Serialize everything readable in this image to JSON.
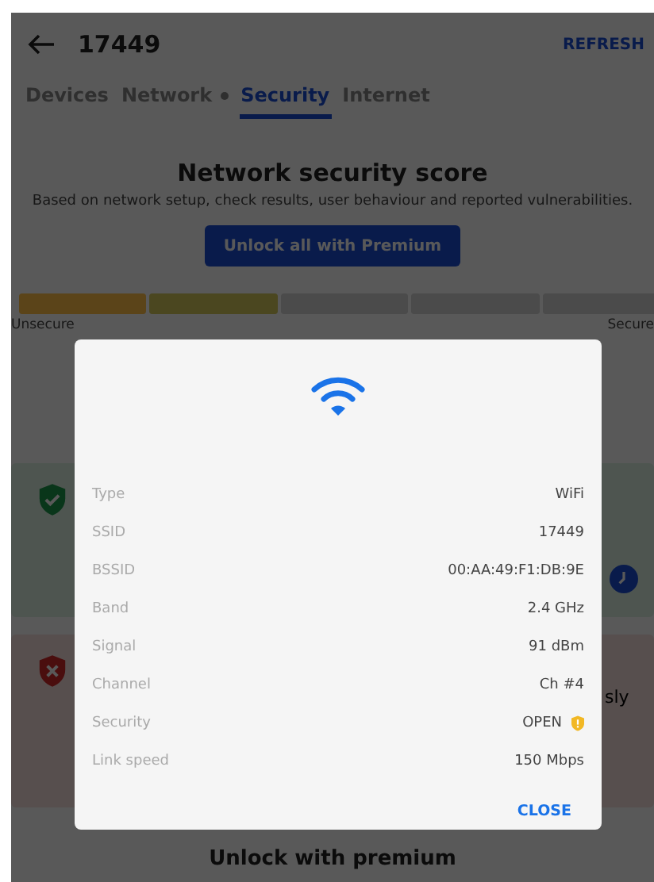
{
  "app_bar": {
    "title": "17449",
    "action": "REFRESH"
  },
  "tabs": [
    {
      "label": "Devices",
      "selected": false,
      "dot": false
    },
    {
      "label": "Network",
      "selected": false,
      "dot": true
    },
    {
      "label": "Security",
      "selected": true,
      "dot": false
    },
    {
      "label": "Internet",
      "selected": false,
      "dot": false
    }
  ],
  "score": {
    "title": "Network security score",
    "description": "Based on network setup, check results, user behaviour and reported vulnerabilities.",
    "button": "Unlock all with Premium",
    "segments": [
      {
        "color": "#5b4419"
      },
      {
        "color": "#4b4720"
      },
      {
        "color": "#4b4b4b"
      },
      {
        "color": "#4b4b4b"
      },
      {
        "color": "#4b4b4b"
      }
    ],
    "low_label": "Unsecure",
    "high_label": "Secure"
  },
  "cards": [
    {
      "kind": "pass"
    },
    {
      "kind": "fail",
      "text": "sly"
    }
  ],
  "premium_title": "Unlock with premium",
  "dialog": {
    "rows": [
      {
        "label": "Type",
        "value": "WiFi",
        "warning": false
      },
      {
        "label": "SSID",
        "value": "17449",
        "warning": false
      },
      {
        "label": "BSSID",
        "value": "00:AA:49:F1:DB:9E",
        "warning": false
      },
      {
        "label": "Band",
        "value": "2.4 GHz",
        "warning": false
      },
      {
        "label": "Signal",
        "value": "91 dBm",
        "warning": false
      },
      {
        "label": "Channel",
        "value": "Ch #4",
        "warning": false
      },
      {
        "label": "Security",
        "value": "OPEN",
        "warning": true
      },
      {
        "label": "Link speed",
        "value": "150 Mbps",
        "warning": false
      }
    ],
    "button": "CLOSE"
  }
}
